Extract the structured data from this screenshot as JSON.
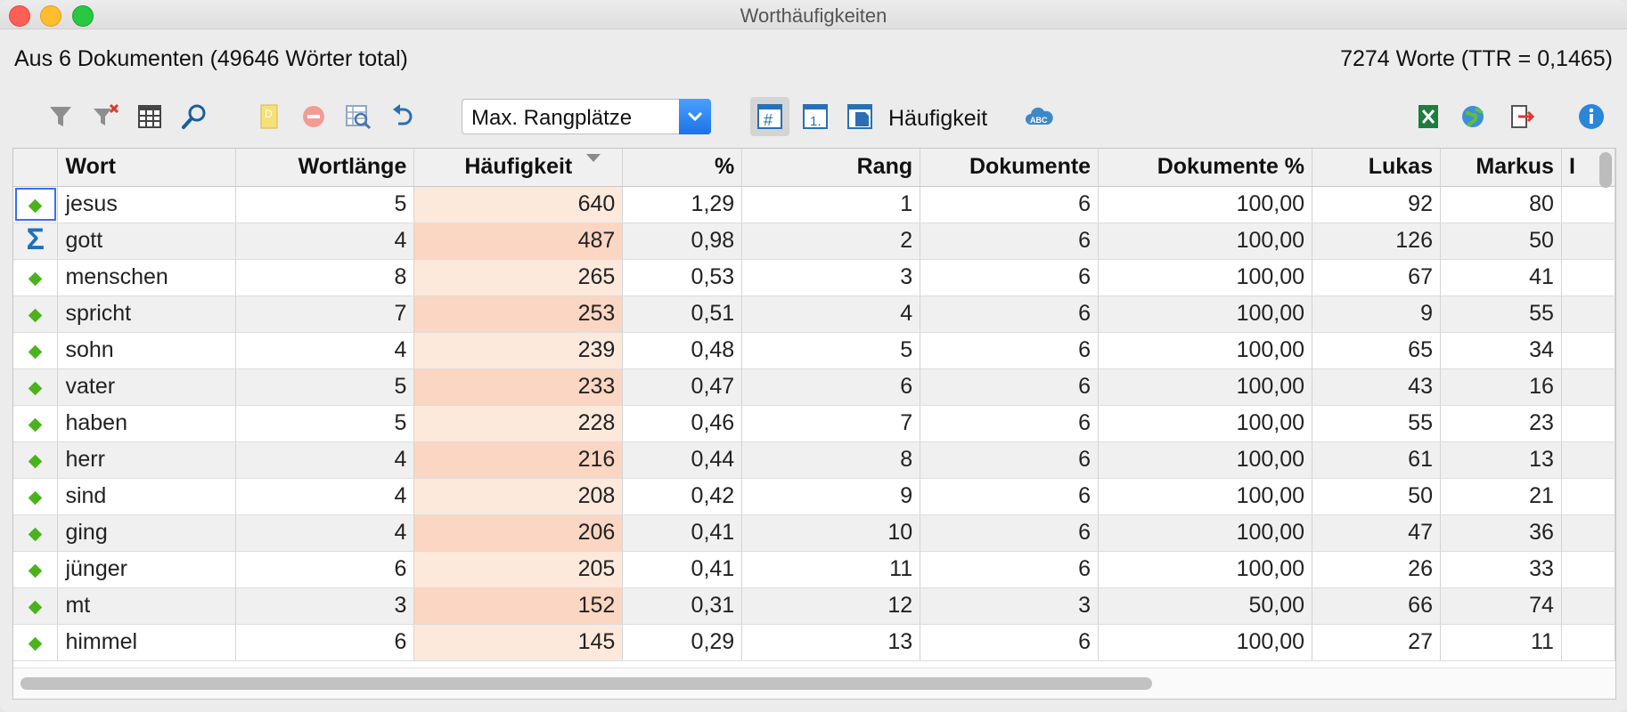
{
  "window": {
    "title": "Worthäufigkeiten"
  },
  "summary": {
    "left": "Aus 6 Dokumenten (49646 Wörter total)",
    "right": "7274 Worte (TTR = 0,1465)"
  },
  "toolbar": {
    "select_value": "Max. Rangplätze",
    "frequency_label": "Häufigkeit",
    "icons": [
      "filter-icon",
      "clear-filter-icon",
      "columns-icon",
      "search-icon",
      "document-icon",
      "stop-icon",
      "zoom-table-icon",
      "undo-icon",
      "hash-icon",
      "rank-icon",
      "document-frequency-icon",
      "word-cloud-icon",
      "excel-icon",
      "globe-icon",
      "export-icon",
      "info-icon"
    ]
  },
  "table": {
    "columns": [
      "",
      "Wort",
      "Wortlänge",
      "Häufigkeit",
      "%",
      "Rang",
      "Dokumente",
      "Dokumente %",
      "Lukas",
      "Markus",
      "I"
    ],
    "sorted_column": "Häufigkeit",
    "rows": [
      {
        "marker": "diamond",
        "wort": "jesus",
        "laenge": "5",
        "haeufigkeit": "640",
        "prozent": "1,29",
        "rang": "1",
        "dokumente": "6",
        "dok_prozent": "100,00",
        "lukas": "92",
        "markus": "80"
      },
      {
        "marker": "sigma",
        "wort": "gott",
        "laenge": "4",
        "haeufigkeit": "487",
        "prozent": "0,98",
        "rang": "2",
        "dokumente": "6",
        "dok_prozent": "100,00",
        "lukas": "126",
        "markus": "50"
      },
      {
        "marker": "diamond",
        "wort": "menschen",
        "laenge": "8",
        "haeufigkeit": "265",
        "prozent": "0,53",
        "rang": "3",
        "dokumente": "6",
        "dok_prozent": "100,00",
        "lukas": "67",
        "markus": "41"
      },
      {
        "marker": "diamond",
        "wort": "spricht",
        "laenge": "7",
        "haeufigkeit": "253",
        "prozent": "0,51",
        "rang": "4",
        "dokumente": "6",
        "dok_prozent": "100,00",
        "lukas": "9",
        "markus": "55"
      },
      {
        "marker": "diamond",
        "wort": "sohn",
        "laenge": "4",
        "haeufigkeit": "239",
        "prozent": "0,48",
        "rang": "5",
        "dokumente": "6",
        "dok_prozent": "100,00",
        "lukas": "65",
        "markus": "34"
      },
      {
        "marker": "diamond",
        "wort": "vater",
        "laenge": "5",
        "haeufigkeit": "233",
        "prozent": "0,47",
        "rang": "6",
        "dokumente": "6",
        "dok_prozent": "100,00",
        "lukas": "43",
        "markus": "16"
      },
      {
        "marker": "diamond",
        "wort": "haben",
        "laenge": "5",
        "haeufigkeit": "228",
        "prozent": "0,46",
        "rang": "7",
        "dokumente": "6",
        "dok_prozent": "100,00",
        "lukas": "55",
        "markus": "23"
      },
      {
        "marker": "diamond",
        "wort": "herr",
        "laenge": "4",
        "haeufigkeit": "216",
        "prozent": "0,44",
        "rang": "8",
        "dokumente": "6",
        "dok_prozent": "100,00",
        "lukas": "61",
        "markus": "13"
      },
      {
        "marker": "diamond",
        "wort": "sind",
        "laenge": "4",
        "haeufigkeit": "208",
        "prozent": "0,42",
        "rang": "9",
        "dokumente": "6",
        "dok_prozent": "100,00",
        "lukas": "50",
        "markus": "21"
      },
      {
        "marker": "diamond",
        "wort": "ging",
        "laenge": "4",
        "haeufigkeit": "206",
        "prozent": "0,41",
        "rang": "10",
        "dokumente": "6",
        "dok_prozent": "100,00",
        "lukas": "47",
        "markus": "36"
      },
      {
        "marker": "diamond",
        "wort": "jünger",
        "laenge": "6",
        "haeufigkeit": "205",
        "prozent": "0,41",
        "rang": "11",
        "dokumente": "6",
        "dok_prozent": "100,00",
        "lukas": "26",
        "markus": "33"
      },
      {
        "marker": "diamond",
        "wort": "mt",
        "laenge": "3",
        "haeufigkeit": "152",
        "prozent": "0,31",
        "rang": "12",
        "dokumente": "3",
        "dok_prozent": "50,00",
        "lukas": "66",
        "markus": "74"
      },
      {
        "marker": "diamond",
        "wort": "himmel",
        "laenge": "6",
        "haeufigkeit": "145",
        "prozent": "0,29",
        "rang": "13",
        "dokumente": "6",
        "dok_prozent": "100,00",
        "lukas": "27",
        "markus": "11"
      }
    ]
  }
}
